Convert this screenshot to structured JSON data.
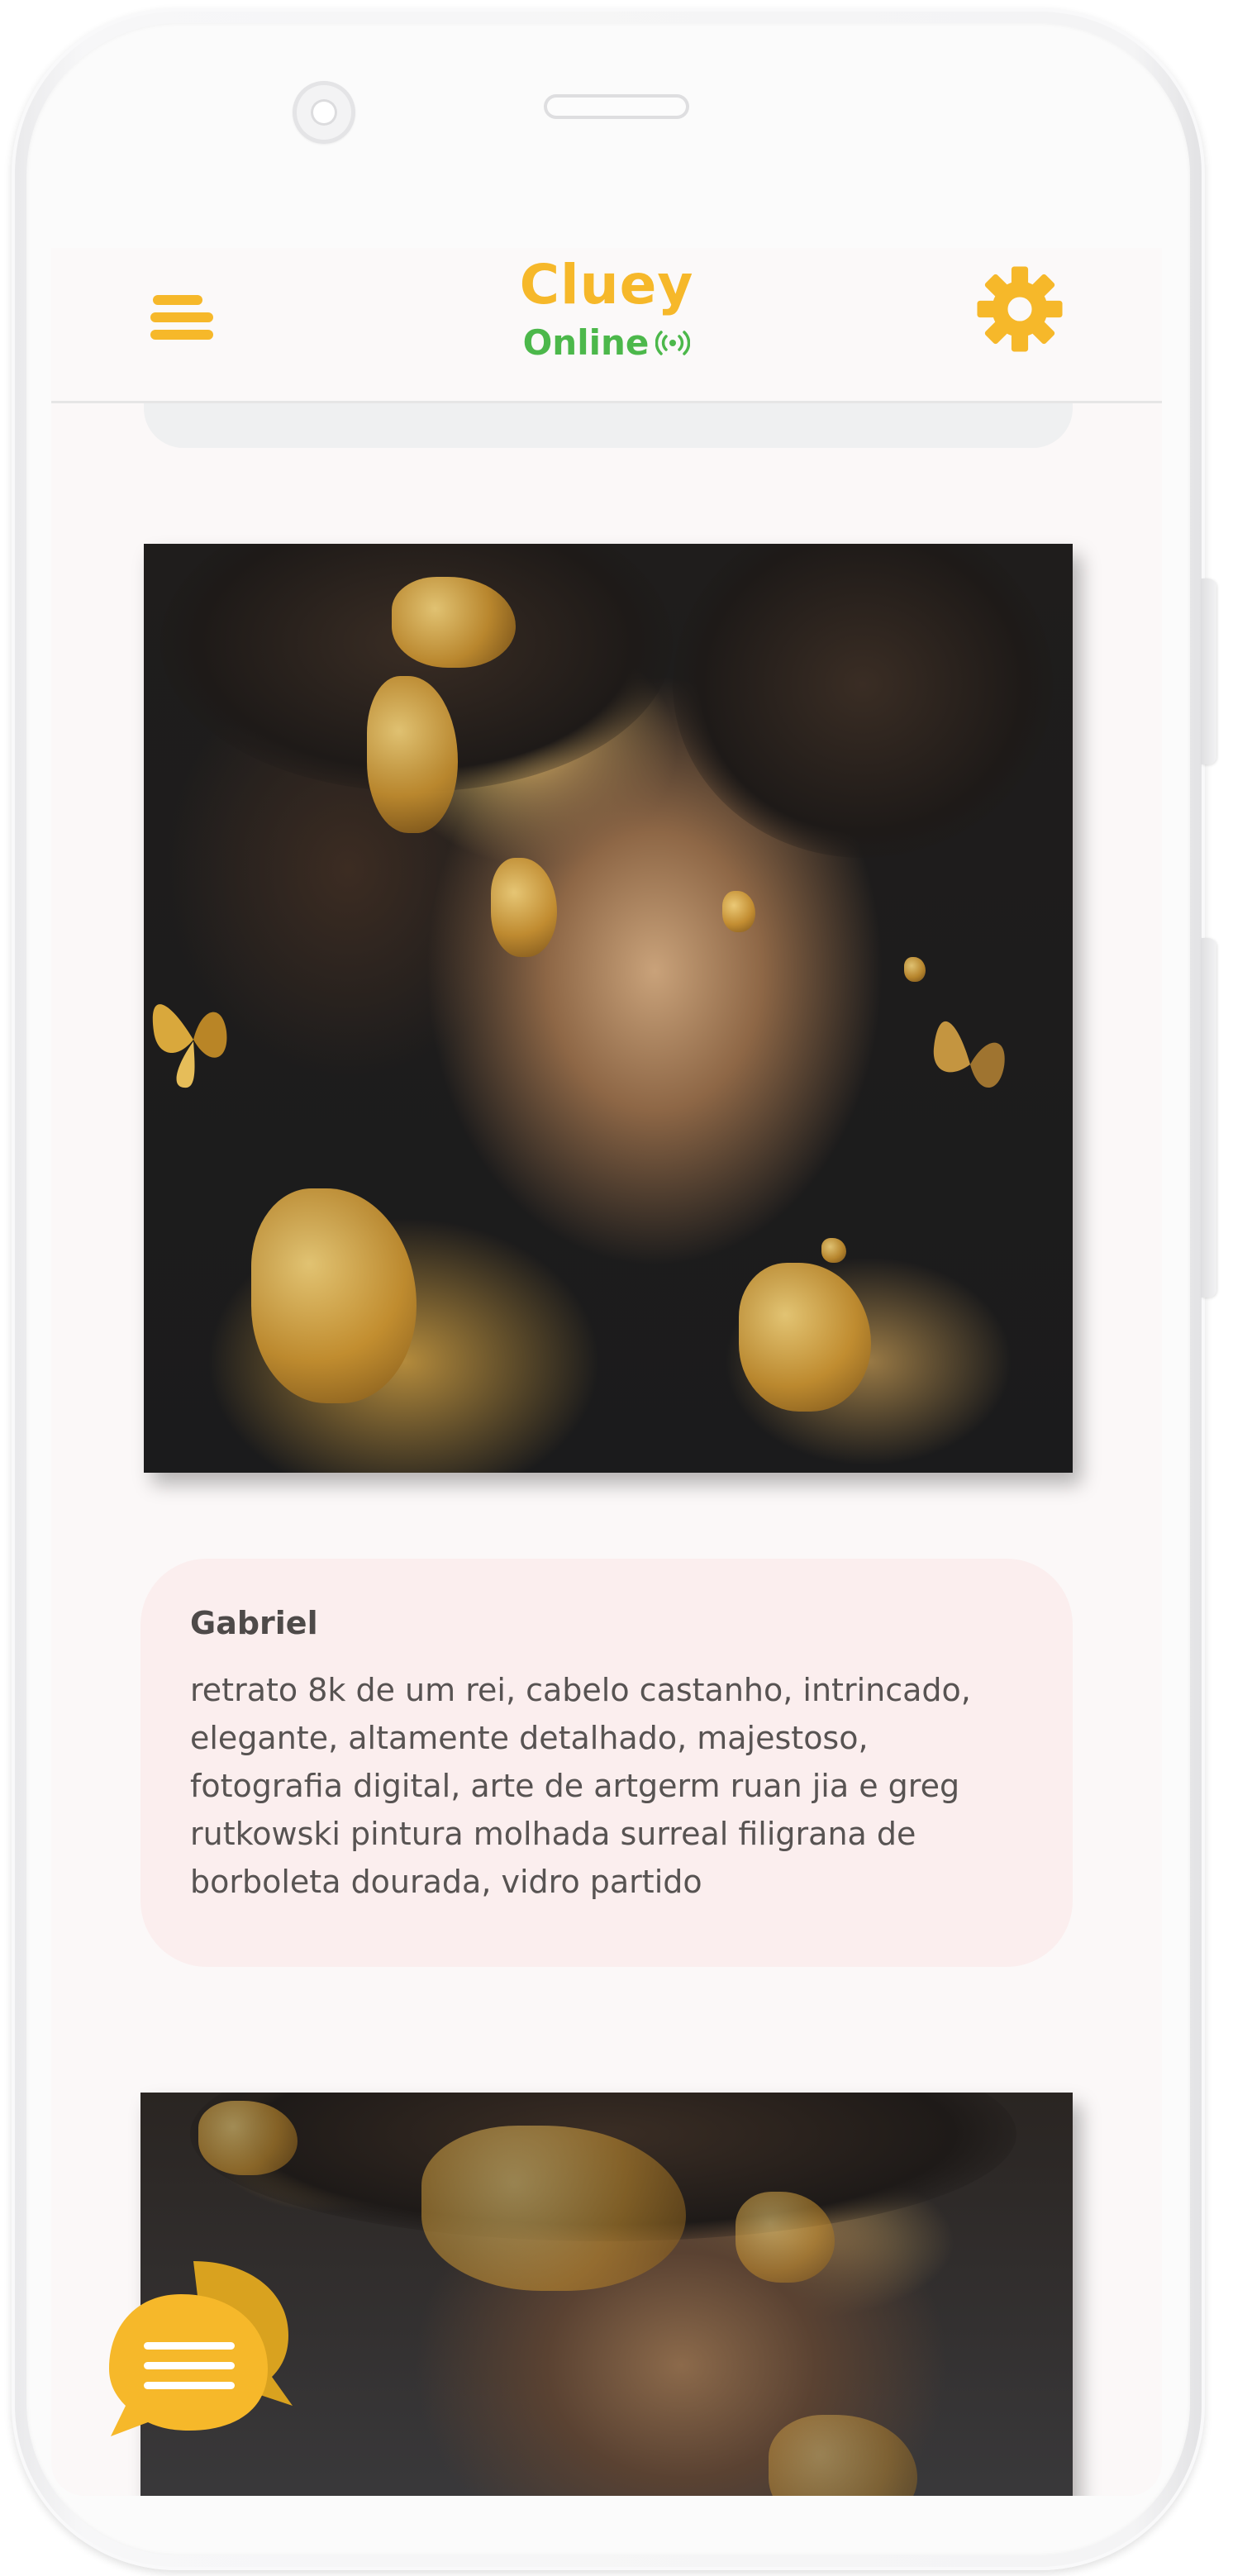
{
  "app": {
    "title": "Cluey",
    "status": "Online"
  },
  "colors": {
    "brand": "#f6b82a",
    "online": "#4cb84b",
    "prompt_card_bg": "#fbeeee",
    "screen_bg": "#fbf8f8"
  },
  "icons": {
    "menu": "hamburger-menu-icon",
    "settings": "gear-icon",
    "status": "signal-broadcast-icon",
    "chat": "chat-bubble-icon"
  },
  "feed": {
    "posts": [
      {
        "author": "Gabriel",
        "prompt": "retrato 8k de um rei, cabelo castanho, intrincado, elegante, altamente detalhado, majestoso, fotografia digital, arte de artgerm ruan jia e greg rutkowski pintura molhada surreal filigrana de borboleta dourada, vidro partido"
      }
    ]
  }
}
